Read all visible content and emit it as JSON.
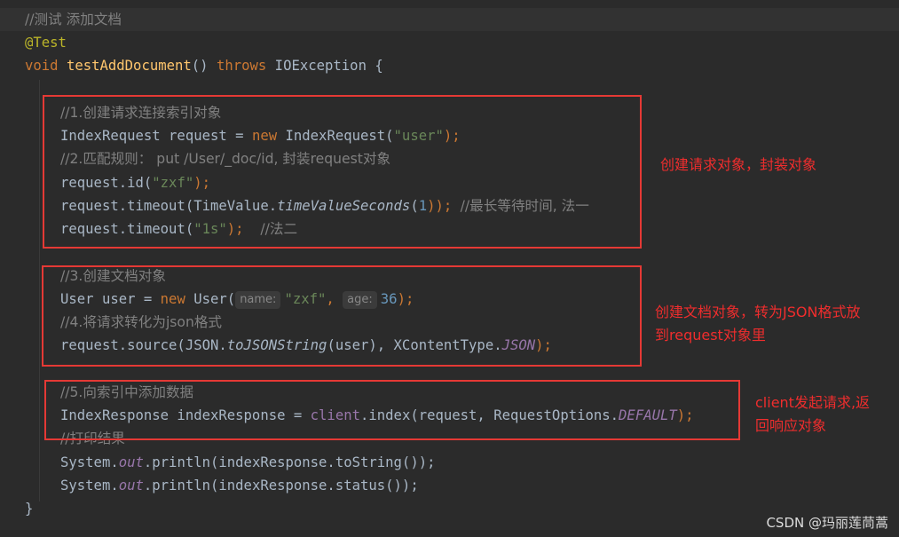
{
  "code": {
    "comment_test": "//测试 添加文档",
    "annotation": "@Test",
    "sig_void": "void ",
    "sig_method": "testAddDocument",
    "sig_paren": "() ",
    "sig_throws": "throws",
    "sig_rest": " IOException {",
    "comment_1": "//1.创建请求连接索引对象",
    "l_req_type": "IndexRequest request = ",
    "l_req_new": "new",
    "l_req_ctor": " IndexRequest(",
    "l_req_str": "\"user\"",
    "l_req_end": ");",
    "comment_2": "//2.匹配规则： put /User/_doc/id, 封装request对象",
    "l_id_a": "request.id(",
    "l_id_str": "\"zxf\"",
    "l_id_end": ");",
    "l_to1_a": "request.timeout(TimeValue.",
    "l_to1_fn": "timeValueSeconds",
    "l_to1_b": "(",
    "l_to1_num": "1",
    "l_to1_c": ")); ",
    "l_to1_cmt": "//最长等待时间, 法一",
    "l_to2_a": "request.timeout(",
    "l_to2_str": "\"1s\"",
    "l_to2_b": ");  ",
    "l_to2_cmt": "//法二",
    "comment_3": "//3.创建文档对象",
    "l_user_a": "User user = ",
    "l_user_new": "new",
    "l_user_b": " User(",
    "hint_name": "name:",
    "l_user_str": "\"zxf\"",
    "l_user_comma": ", ",
    "hint_age": "age:",
    "l_user_num": "36",
    "l_user_end": ");",
    "comment_4": "//4.将请求转化为json格式",
    "l_src_a": "request.source(JSON.",
    "l_src_fn": "toJSONString",
    "l_src_b": "(user), XContentType.",
    "l_src_const": "JSON",
    "l_src_end": ");",
    "comment_5": "//5.向索引中添加数据",
    "l_resp_a": "IndexResponse indexResponse = ",
    "l_resp_client": "client",
    "l_resp_b": ".index(request, RequestOptions.",
    "l_resp_const": "DEFAULT",
    "l_resp_end": ");",
    "comment_print": "//打印结果",
    "l_p1_a": "System.",
    "l_p1_out": "out",
    "l_p1_b": ".println(indexResponse.toString());",
    "l_p2_a": "System.",
    "l_p2_out": "out",
    "l_p2_b": ".println(indexResponse.status());",
    "close_brace": "}"
  },
  "annotations": {
    "note1": "创建请求对象，封装对象",
    "note2_line1": "创建文档对象，转为JSON格式放",
    "note2_line2": "到request对象里",
    "note3_line1": "client发起请求,返",
    "note3_line2": "回响应对象"
  },
  "watermark": "CSDN @玛丽莲茼蒿",
  "colors": {
    "background": "#2b2b2b",
    "keyword": "#cc7832",
    "string": "#6a8759",
    "number": "#6897bb",
    "comment": "#808080",
    "method": "#ffc66d",
    "annotation": "#bbb529",
    "field": "#9876aa",
    "highlight_box": "#e53935"
  }
}
